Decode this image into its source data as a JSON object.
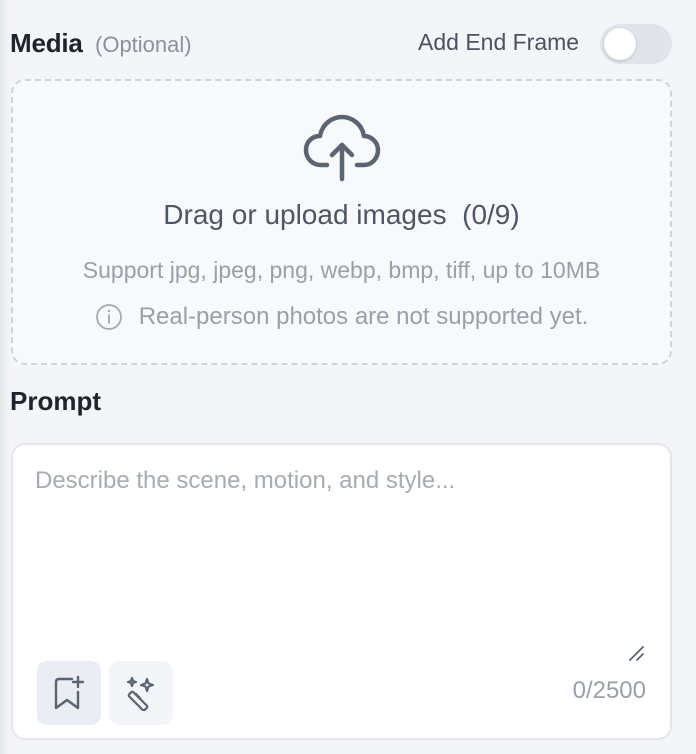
{
  "media": {
    "title": "Media",
    "optional": "(Optional)",
    "end_frame_label": "Add End Frame",
    "end_frame_enabled": false
  },
  "upload": {
    "icon": "cloud-upload-icon",
    "title": "Drag or upload images  (0/9)",
    "formats": "Support jpg, jpeg, png, webp, bmp, tiff, up to 10MB",
    "note_icon": "info-icon",
    "note": "Real-person photos are not supported yet."
  },
  "prompt": {
    "label": "Prompt",
    "placeholder": "Describe the scene, motion, and style...",
    "value": "",
    "char_count": "0/2500",
    "tools": [
      {
        "icon": "bookmark-add-icon"
      },
      {
        "icon": "magic-wand-icon"
      }
    ]
  },
  "colors": {
    "background": "#f4f5f8",
    "panel": "#ffffff",
    "title_text": "#1f232b",
    "muted_text": "#9aa0aa",
    "icon": "#5c6472"
  }
}
